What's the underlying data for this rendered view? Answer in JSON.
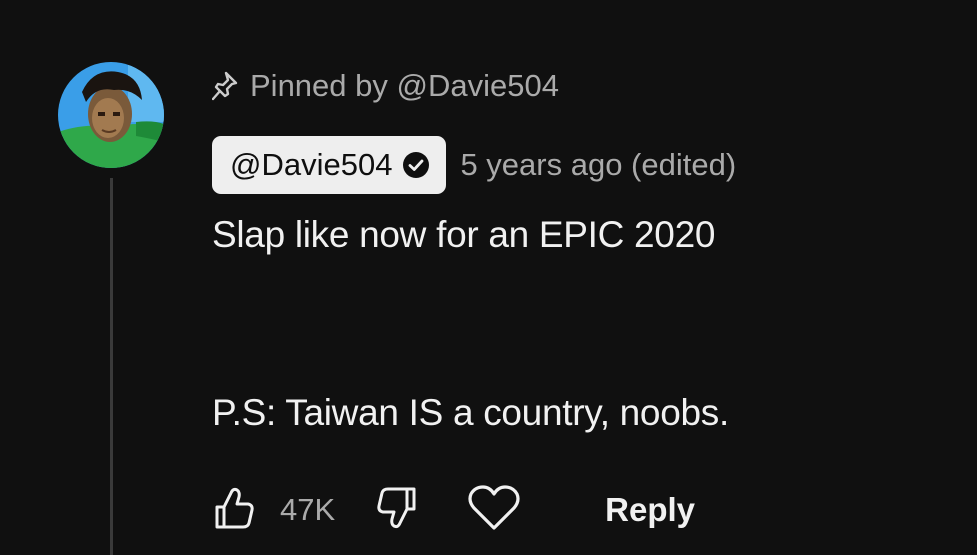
{
  "comment": {
    "pinned_label": "Pinned by @Davie504",
    "author": "@Davie504",
    "timestamp": "5 years ago (edited)",
    "body_lines": [
      "Slap like now for an EPIC 2020",
      "P.S: Taiwan IS a country, noobs."
    ],
    "like_count": "47K",
    "reply_label": "Reply"
  },
  "icons": {
    "pin": "pin-icon",
    "verified": "verified-check-icon",
    "like": "thumbs-up-icon",
    "dislike": "thumbs-down-icon",
    "heart": "heart-icon"
  },
  "colors": {
    "background": "#101010",
    "primary_text": "#f1f1f1",
    "secondary_text": "#aaaaaa",
    "author_chip_bg": "#eeeeee",
    "thread_line": "#3a3a3a"
  }
}
